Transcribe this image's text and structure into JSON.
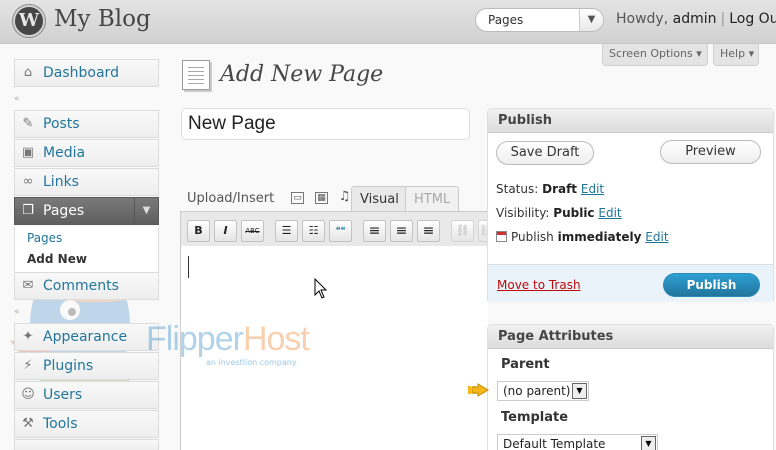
{
  "header": {
    "site_title": "My Blog",
    "logo_glyph": "W",
    "favorites_selected": "Pages",
    "howdy_prefix": "Howdy, ",
    "username": "admin",
    "separator": "|",
    "logout_label": "Log Out"
  },
  "screen_meta": {
    "screen_options_label": "Screen Options",
    "help_label": "Help",
    "arrow": "▾"
  },
  "menu": {
    "dashboard": "Dashboard",
    "posts": "Posts",
    "media": "Media",
    "links": "Links",
    "pages": "Pages",
    "comments": "Comments",
    "appearance": "Appearance",
    "plugins": "Plugins",
    "users": "Users",
    "tools": "Tools",
    "separator_glyph": "«",
    "submenu": {
      "pages": "Pages",
      "add_new": "Add New"
    }
  },
  "page": {
    "title": "Add New Page",
    "post_title_value": "New Page"
  },
  "editor": {
    "upload_insert_label": "Upload/Insert",
    "tab_visual": "Visual",
    "tab_html": "HTML",
    "toolbar": {
      "bold": "B",
      "italic": "I",
      "strike": "ABC",
      "bullets": "☰",
      "numbers": "☷",
      "quote": "❝❝",
      "align_left": "≡",
      "align_center": "≡",
      "align_right": "≡",
      "link": "⛓",
      "unlink": "⛓"
    }
  },
  "watermark": {
    "brand_part1": "Flipper",
    "brand_part2": "Host",
    "tagline": "an investlion company"
  },
  "publish": {
    "heading": "Publish",
    "save_draft_label": "Save Draft",
    "preview_label": "Preview",
    "status_label": "Status: ",
    "status_value": "Draft",
    "visibility_label": "Visibility: ",
    "visibility_value": "Public",
    "publish_label": "Publish ",
    "publish_value": "immediately",
    "edit_label": "Edit",
    "move_to_trash_label": "Move to Trash",
    "publish_button_label": "Publish"
  },
  "page_attributes": {
    "heading": "Page Attributes",
    "parent_label": "Parent",
    "parent_value": "(no parent)",
    "template_label": "Template",
    "template_value": "Default Template"
  },
  "colors": {
    "link": "#21759b",
    "publish_button": "#21759b",
    "trash": "#bc0b0b",
    "pointer_arrow": "#f5b81c"
  }
}
